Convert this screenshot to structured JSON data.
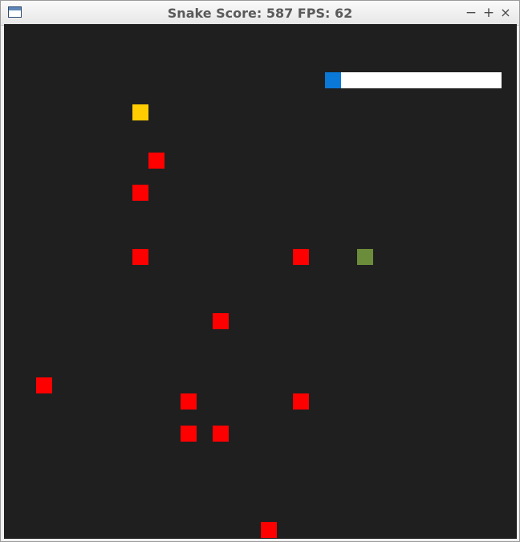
{
  "window": {
    "title": "Snake Score: 587 FPS: 62",
    "minimize_glyph": "−",
    "maximize_glyph": "+",
    "close_glyph": "×"
  },
  "game": {
    "score": 587,
    "fps": 62,
    "progress_fraction": 0.09,
    "colors": {
      "board": "#1f1f1f",
      "obstacle": "#ff0000",
      "food": "#ffcc00",
      "snake_head": "#6b8c3a",
      "progress_fill": "#0a78d7",
      "progress_track": "#ffffff"
    },
    "food": {
      "col": 8,
      "row": 5
    },
    "snake": [
      {
        "col": 22,
        "row": 14
      }
    ],
    "obstacles": [
      {
        "col": 9,
        "row": 8
      },
      {
        "col": 8,
        "row": 10
      },
      {
        "col": 8,
        "row": 14
      },
      {
        "col": 18,
        "row": 14
      },
      {
        "col": 13,
        "row": 18
      },
      {
        "col": 2,
        "row": 22
      },
      {
        "col": 11,
        "row": 23
      },
      {
        "col": 18,
        "row": 23
      },
      {
        "col": 11,
        "row": 25
      },
      {
        "col": 13,
        "row": 25
      },
      {
        "col": 16,
        "row": 31
      }
    ]
  }
}
